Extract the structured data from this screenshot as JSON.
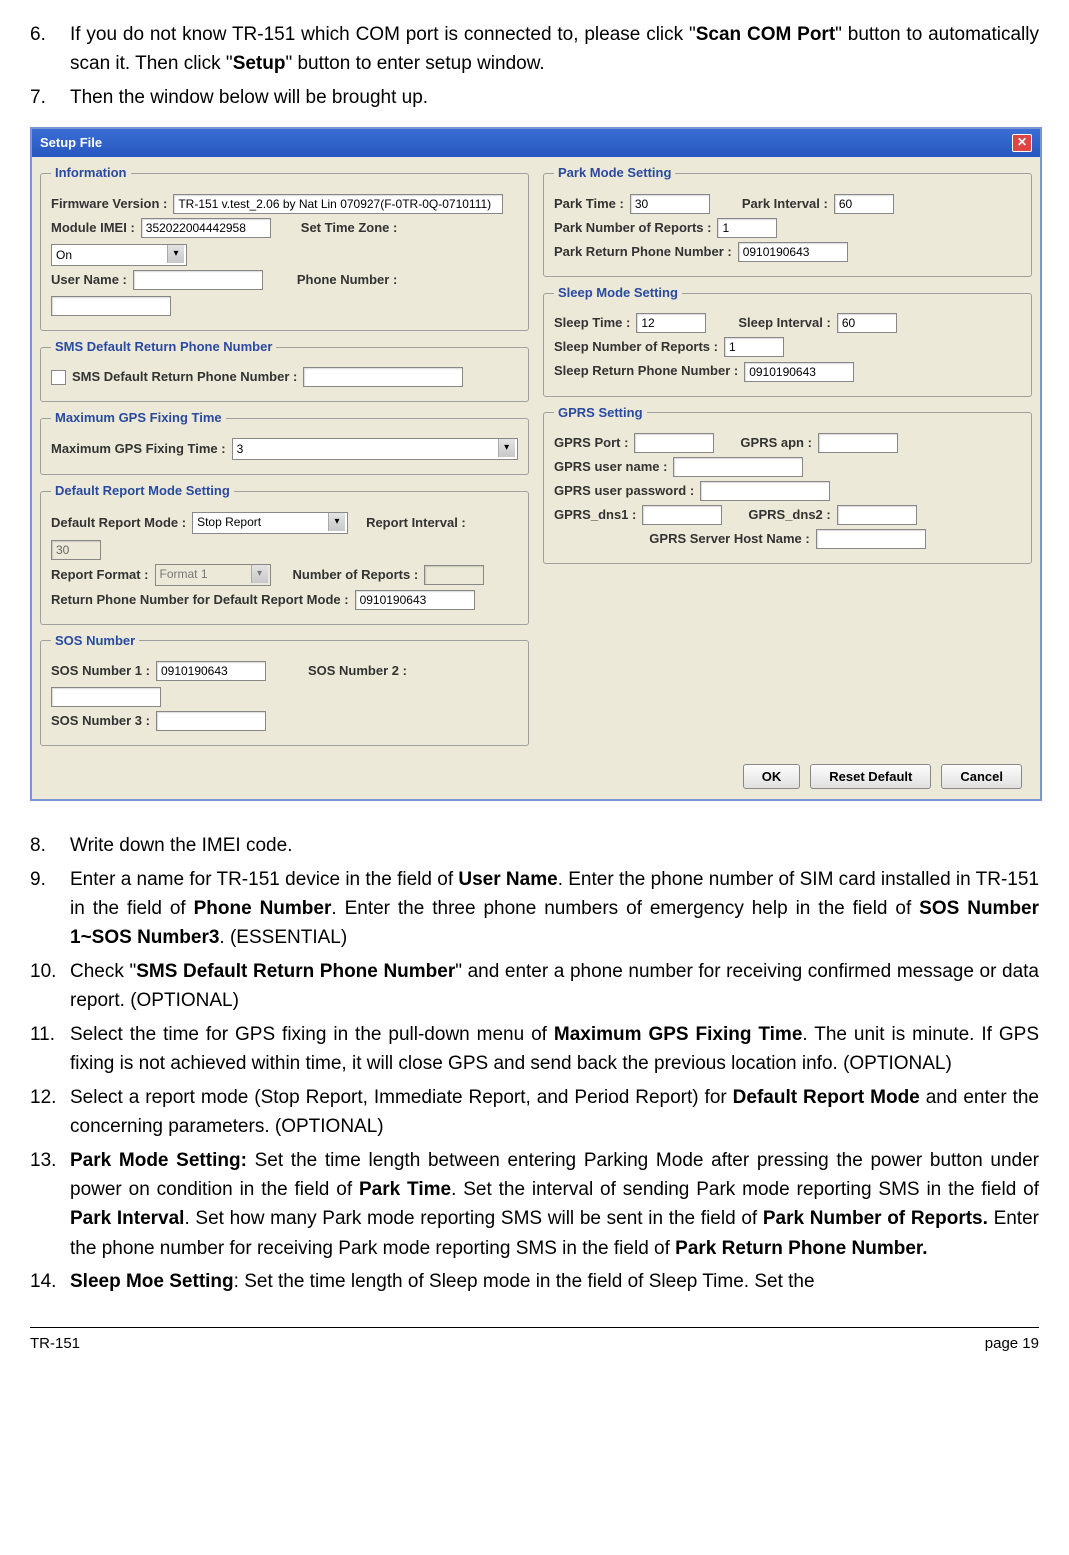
{
  "steps": {
    "s6": {
      "n": "6.",
      "text_a": "If you do not know TR-151 which COM port is connected to, please click \"",
      "b1": "Scan COM Port",
      "text_b": "\" button to automatically scan it. Then click \"",
      "b2": "Setup",
      "text_c": "\" button to enter setup window."
    },
    "s7": {
      "n": "7.",
      "text": "Then the window below will be brought up."
    },
    "s8": {
      "n": "8.",
      "text": "Write down the IMEI code."
    },
    "s9": {
      "n": "9.",
      "text_a": "Enter a name for TR-151 device in the field of ",
      "b1": "User Name",
      "text_b": ". Enter the phone number of SIM card installed in TR-151 in the field of ",
      "b2": "Phone Number",
      "text_c": ". Enter the three phone numbers of emergency help in the field of ",
      "b3": "SOS Number 1~SOS Number3",
      "text_d": ". (ESSENTIAL)"
    },
    "s10": {
      "n": "10.",
      "text_a": "Check \"",
      "b1": "SMS Default Return Phone Number",
      "text_b": "\" and enter a phone number for receiving confirmed message or data report. (OPTIONAL)"
    },
    "s11": {
      "n": "11.",
      "text_a": "Select the time for GPS fixing in the pull-down menu of ",
      "b1": "Maximum GPS Fixing Time",
      "text_b": ". The unit is minute. If GPS fixing is not achieved within time, it will close GPS and send back the previous location info. (OPTIONAL)"
    },
    "s12": {
      "n": "12.",
      "text_a": "Select a report mode (Stop Report, Immediate Report, and Period Report) for ",
      "b1": "Default Report Mode",
      "text_b": " and enter the concerning parameters. (OPTIONAL)"
    },
    "s13": {
      "n": "13.",
      "b0": "Park Mode Setting:",
      "text_a": " Set the time length between entering Parking Mode after pressing the power button under power on condition in the field of ",
      "b1": "Park Time",
      "text_b": ". Set the interval of sending Park mode reporting SMS in the field of ",
      "b2": "Park Interval",
      "text_c": ". Set how many Park mode reporting SMS will be sent in the field of ",
      "b3": "Park Number of Reports.",
      "text_d": " Enter the phone number for receiving Park mode reporting SMS in the field of ",
      "b4": "Park Return Phone Number."
    },
    "s14": {
      "n": "14.",
      "b0": "Sleep Moe Setting",
      "text_a": ": Set the time length of Sleep mode in the field of Sleep Time. Set the"
    }
  },
  "dlg": {
    "title": "Setup File",
    "info": {
      "legend": "Information",
      "fw_lbl": "Firmware Version :",
      "fw": "TR-151 v.test_2.06 by Nat Lin 070927(F-0TR-0Q-0710111)",
      "imei_lbl": "Module IMEI :",
      "imei": "352022004442958",
      "tz_lbl": "Set Time Zone :",
      "tz": "On",
      "user_lbl": "User Name :",
      "user": "",
      "phone_lbl": "Phone Number :",
      "phone": ""
    },
    "sms": {
      "legend": "SMS Default Return Phone Number",
      "lbl": "SMS Default Return Phone Number :",
      "val": ""
    },
    "gps": {
      "legend": "Maximum GPS Fixing Time",
      "lbl": "Maximum GPS Fixing Time :",
      "val": "3"
    },
    "rep": {
      "legend": "Default Report Mode Setting",
      "mode_lbl": "Default Report Mode :",
      "mode": "Stop Report",
      "int_lbl": "Report Interval :",
      "int": "30",
      "fmt_lbl": "Report Format :",
      "fmt": "Format 1",
      "num_lbl": "Number of Reports :",
      "num": "",
      "ret_lbl": "Return Phone Number for Default Report Mode :",
      "ret": "0910190643"
    },
    "sos": {
      "legend": "SOS Number",
      "n1_lbl": "SOS Number 1 :",
      "n1": "0910190643",
      "n2_lbl": "SOS Number 2 :",
      "n2": "",
      "n3_lbl": "SOS Number 3 :",
      "n3": ""
    },
    "park": {
      "legend": "Park Mode Setting",
      "time_lbl": "Park Time :",
      "time": "30",
      "int_lbl": "Park Interval :",
      "int": "60",
      "num_lbl": "Park Number of Reports :",
      "num": "1",
      "ret_lbl": "Park Return Phone Number  :",
      "ret": "0910190643"
    },
    "sleep": {
      "legend": "Sleep Mode Setting",
      "time_lbl": "Sleep Time :",
      "time": "12",
      "int_lbl": "Sleep Interval :",
      "int": "60",
      "num_lbl": "Sleep Number of Reports :",
      "num": "1",
      "ret_lbl": "Sleep Return Phone Number  :",
      "ret": "0910190643"
    },
    "gprs": {
      "legend": "GPRS Setting",
      "port_lbl": "GPRS Port :",
      "port": "",
      "apn_lbl": "GPRS apn :",
      "apn": "",
      "un_lbl": "GPRS user name :",
      "un": "",
      "pw_lbl": "GPRS user password :",
      "pw": "",
      "d1_lbl": "GPRS_dns1 :",
      "d1": "",
      "d2_lbl": "GPRS_dns2 :",
      "d2": "",
      "host_lbl": "GPRS Server Host Name :",
      "host": ""
    },
    "btns": {
      "ok": "OK",
      "reset": "Reset Default",
      "cancel": "Cancel"
    }
  },
  "footer": {
    "left": "TR-151",
    "right": "page 19"
  }
}
